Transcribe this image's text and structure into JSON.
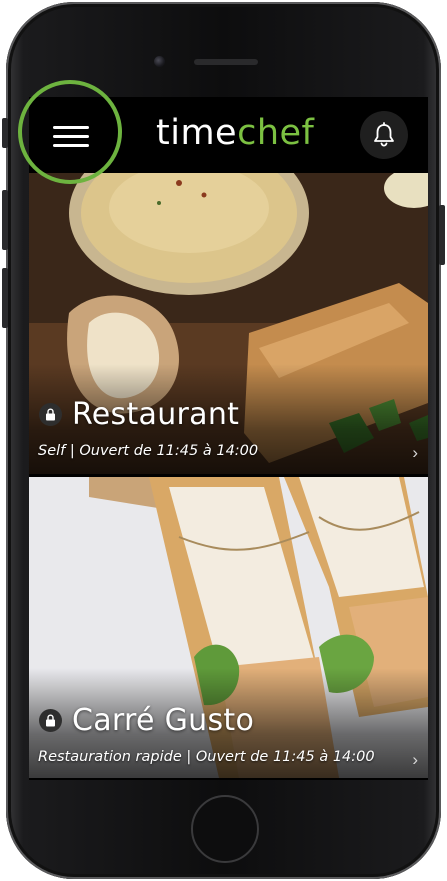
{
  "header": {
    "logo_part1": "time",
    "logo_part2": "chef",
    "menu_icon": "hamburger-menu-icon",
    "notification_icon": "bell-icon"
  },
  "cards": [
    {
      "title": "Restaurant",
      "subtitle": "Self | Ouvert de 11:45 à 14:00",
      "lock_icon": "lock-icon",
      "chevron": "›"
    },
    {
      "title": "Carré Gusto",
      "subtitle": "Restauration rapide | Ouvert de 11:45 à 14:00",
      "lock_icon": "lock-icon",
      "chevron": "›"
    }
  ],
  "colors": {
    "brand_green": "#7cc142",
    "highlight_ring": "#6db33f",
    "header_bg": "#000000"
  }
}
